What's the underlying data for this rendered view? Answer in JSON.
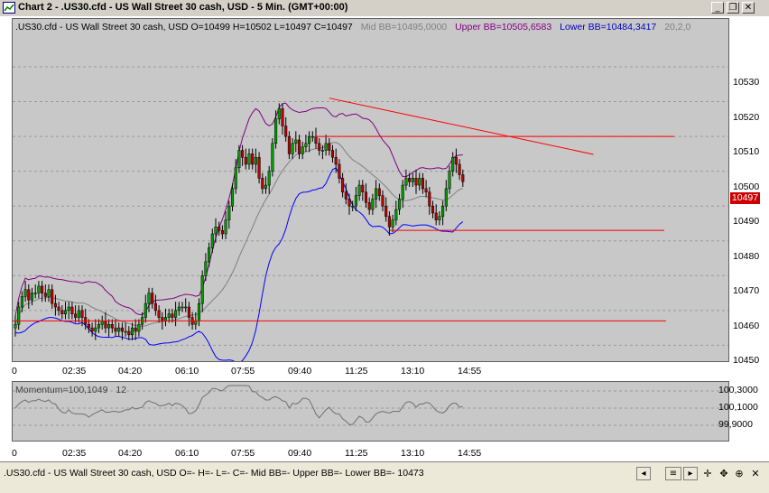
{
  "window": {
    "title": "Chart 2 - .US30.cfd - US Wall Street 30 cash, USD - 5 Min. (GMT+00:00)",
    "minimize_glyph": "_",
    "restore_glyph": "❐",
    "close_glyph": "✕"
  },
  "header": {
    "symbol_info": ".US30.cfd - US Wall Street 30 cash, USD O=10499 H=10502 L=10497 C=10497",
    "mid_bb": "Mid BB=10495,0000",
    "upper_bb": "Upper BB=10505,6583",
    "lower_bb": "Lower BB=10484,3417",
    "bb_params": "20,2,0"
  },
  "colors": {
    "panel_bg": "#c8c8c8",
    "candle_up": "#00a000",
    "candle_down": "#c00000",
    "upper_bb": "#800080",
    "lower_bb": "#0000ff",
    "mid_bb": "#808080",
    "trendline": "#ff0000"
  },
  "price_axis": {
    "labels": [
      "10530",
      "10520",
      "10510",
      "10500",
      "10490",
      "10480",
      "10470",
      "10460",
      "10450"
    ],
    "current_price": "10497"
  },
  "time_axis": {
    "labels": [
      "0",
      "02:35",
      "04:20",
      "06:10",
      "07:55",
      "09:40",
      "11:25",
      "13:10",
      "14:55"
    ]
  },
  "momentum": {
    "label": "Momentum=100,1049",
    "period": "12",
    "axis_labels": [
      "100,3000",
      "100,1000",
      "99,9000"
    ]
  },
  "time_axis_2": {
    "labels": [
      "0",
      "02:35",
      "04:20",
      "06:10",
      "07:55",
      "09:40",
      "11:25",
      "13:10",
      "14:55"
    ]
  },
  "status": {
    "text": ".US30.cfd - US Wall Street 30 cash, USD O=- H=- L=- C=-  Mid BB=- Upper BB=- Lower BB=-   10473",
    "icons": [
      "scroll-left",
      "scrollbar",
      "scroll-right",
      "crosshair",
      "pan",
      "zoom-in",
      "zoom-out",
      "close"
    ]
  },
  "chart_data": {
    "type": "candlestick",
    "title": ".US30.cfd - US Wall Street 30 cash, USD - 5 Min.",
    "xlabel": "",
    "ylabel": "",
    "ylim": [
      10445,
      10537
    ],
    "x_ticks": [
      "0",
      "02:35",
      "04:20",
      "06:10",
      "07:55",
      "09:40",
      "11:25",
      "13:10",
      "14:55"
    ],
    "close_series": [
      10456,
      10461,
      10464,
      10466,
      10463,
      10465,
      10465,
      10467,
      10465,
      10464,
      10466,
      10462,
      10461,
      10460,
      10459,
      10460,
      10461,
      10459,
      10458,
      10460,
      10458,
      10456,
      10455,
      10454,
      10455,
      10456,
      10457,
      10455,
      10456,
      10455,
      10454,
      10455,
      10454,
      10454,
      10453,
      10455,
      10454,
      10456,
      10458,
      10462,
      10465,
      10462,
      10460,
      10458,
      10457,
      10458,
      10459,
      10458,
      10460,
      10461,
      10461,
      10461,
      10458,
      10456,
      10457,
      10462,
      10470,
      10474,
      10478,
      10482,
      10484,
      10483,
      10482,
      10486,
      10490,
      10495,
      10501,
      10506,
      10504,
      10502,
      10505,
      10502,
      10504,
      10498,
      10495,
      10496,
      10500,
      10508,
      10515,
      10518,
      10513,
      10510,
      10505,
      10508,
      10509,
      10505,
      10507,
      10508,
      10510,
      10510,
      10508,
      10506,
      10506,
      10508,
      10506,
      10504,
      10502,
      10498,
      10494,
      10492,
      10490,
      10490,
      10493,
      10496,
      10494,
      10491,
      10489,
      10492,
      10495,
      10493,
      10490,
      10487,
      10484,
      10486,
      10489,
      10492,
      10496,
      10498,
      10497,
      10498,
      10496,
      10498,
      10495,
      10494,
      10490,
      10488,
      10486,
      10487,
      10490,
      10495,
      10500,
      10504,
      10502,
      10499,
      10497
    ],
    "bollinger_bands": {
      "period": 20,
      "deviation": 2,
      "shift": 0
    },
    "horizontal_lines": [
      10510,
      10483,
      10457
    ],
    "trendline": {
      "from": [
        "09:00",
        10521
      ],
      "to": [
        "14:55",
        10506.5
      ]
    },
    "indicator": {
      "name": "Momentum",
      "period": 12,
      "value": 100.1049,
      "ylim": [
        99.8,
        100.4
      ]
    }
  }
}
